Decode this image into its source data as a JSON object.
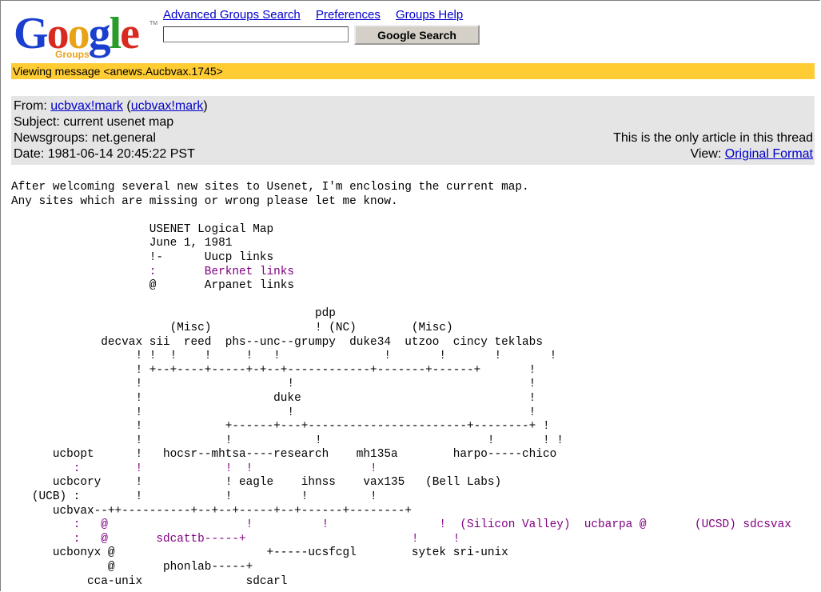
{
  "logo": {
    "letters": [
      "G",
      "o",
      "o",
      "g",
      "l",
      "e"
    ],
    "colors": [
      "#1a3fcf",
      "#d82a20",
      "#e8a317",
      "#1a3fcf",
      "#2a9c2c",
      "#d82a20"
    ],
    "sub": "Groups",
    "tm": "TM"
  },
  "nav": {
    "advanced": "Advanced Groups Search",
    "preferences": "Preferences",
    "help": "Groups Help"
  },
  "search": {
    "value": "",
    "button": "Google Search"
  },
  "viewing": "Viewing message <anews.Aucbvax.1745>",
  "message": {
    "from_label": "From:",
    "from_name": "ucbvax!mark",
    "from_addr": "ucbvax!mark",
    "subject_label": "Subject:",
    "subject": "current usenet map",
    "newsgroups_label": "Newsgroups:",
    "newsgroups": "net.general",
    "date_label": "Date:",
    "date": "1981-06-14 20:45:22 PST",
    "thread_note": "This is the only article in this thread",
    "view_label": "View:",
    "view_link": "Original Format"
  },
  "body": {
    "lines": [
      [
        [
          "After welcoming several new sites to Usenet, I'm enclosing the current map.",
          0
        ]
      ],
      [
        [
          "Any sites which are missing or wrong please let me know.",
          0
        ]
      ],
      [
        [
          "",
          0
        ]
      ],
      [
        [
          "                    USENET Logical Map",
          0
        ]
      ],
      [
        [
          "                    June 1, 1981",
          0
        ]
      ],
      [
        [
          "                    !-      Uucp links",
          0
        ]
      ],
      [
        [
          "                    :       Berknet links",
          1
        ]
      ],
      [
        [
          "                    @       Arpanet links",
          0
        ]
      ],
      [
        [
          "",
          0
        ]
      ],
      [
        [
          "                                            pdp",
          0
        ]
      ],
      [
        [
          "                       (Misc)               ! (NC)        (Misc)",
          0
        ]
      ],
      [
        [
          "             decvax sii  reed  phs--unc--grumpy  duke34  utzoo  cincy teklabs",
          0
        ]
      ],
      [
        [
          "                  ! !  !    !     !   !               !       !       !       !",
          0
        ]
      ],
      [
        [
          "                  ! +--+----+-----+-+--+------------+-------+------+       !",
          0
        ]
      ],
      [
        [
          "                  !                     !                                  !",
          0
        ]
      ],
      [
        [
          "                  !                   duke                                 !",
          0
        ]
      ],
      [
        [
          "                  !                     !                                  !",
          0
        ]
      ],
      [
        [
          "                  !            +------+---+-----------------------+--------+ !",
          0
        ]
      ],
      [
        [
          "                  !            !            !                        !       ! !",
          0
        ]
      ],
      [
        [
          "      ucbopt      !   hocsr--mhtsa----research    mh135a        harpo-----chico",
          0
        ]
      ],
      [
        [
          "         :        !            !  !                 !",
          1
        ]
      ],
      [
        [
          "      ucbcory     !            ! eagle    ihnss    vax135   (Bell Labs)",
          0
        ]
      ],
      [
        [
          "   (UCB) :        !            !          !         !",
          0
        ]
      ],
      [
        [
          "      ucbvax--++----------+--+--+-----+--+------+--------+",
          0
        ]
      ],
      [
        [
          "         :   @                    !          !                !  (Silicon Valley)  ucbarpa @       (UCSD) sdcsvax",
          1
        ]
      ],
      [
        [
          "         :   @       sdcattb-----+                        !     !",
          1
        ]
      ],
      [
        [
          "      ucbonyx @                      +-----ucsfcgl        sytek sri-unix",
          0
        ]
      ],
      [
        [
          "              @       phonlab-----+",
          0
        ]
      ],
      [
        [
          "           cca-unix               sdcarl",
          0
        ]
      ]
    ]
  }
}
